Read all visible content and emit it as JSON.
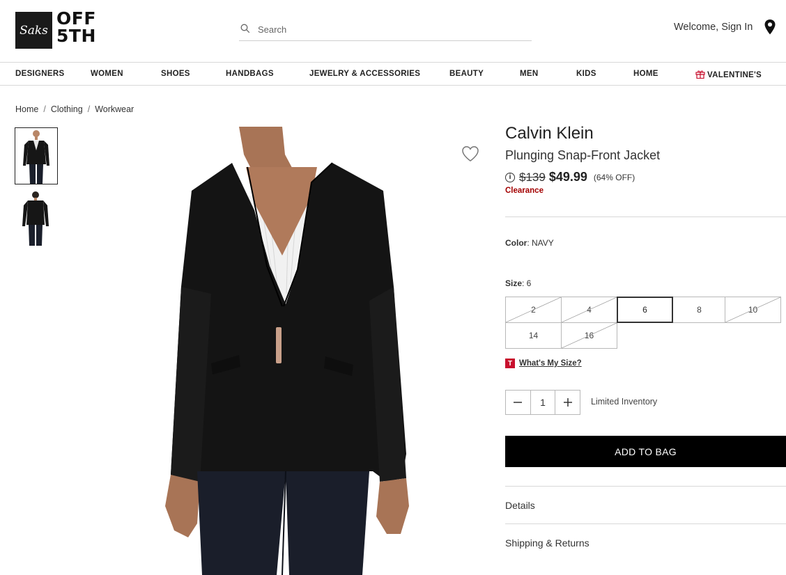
{
  "header": {
    "logo_script": "Saks",
    "logo_line1": "OFF",
    "logo_line2": "5TH",
    "search_placeholder": "Search",
    "welcome": "Welcome, Sign In"
  },
  "nav": [
    "DESIGNERS",
    "WOMEN",
    "SHOES",
    "HANDBAGS",
    "JEWELRY & ACCESSORIES",
    "BEAUTY",
    "MEN",
    "KIDS",
    "HOME",
    "VALENTINE'S"
  ],
  "breadcrumb": [
    "Home",
    "Clothing",
    "Workwear"
  ],
  "product": {
    "brand": "Calvin Klein",
    "name": "Plunging Snap-Front Jacket",
    "original_price": "$139",
    "sale_price": "$49.99",
    "discount": "(64% OFF)",
    "badge": "Clearance",
    "color_label": "Color",
    "color_value": ": NAVY",
    "size_label": "Size",
    "size_value": ": 6",
    "sizes": [
      {
        "label": "2",
        "available": false
      },
      {
        "label": "4",
        "available": false
      },
      {
        "label": "6",
        "available": true,
        "selected": true
      },
      {
        "label": "8",
        "available": true
      },
      {
        "label": "10",
        "available": false
      },
      {
        "label": "14",
        "available": true
      },
      {
        "label": "16",
        "available": false
      }
    ],
    "whats_my_size": "What's My Size?",
    "quantity": "1",
    "inventory_note": "Limited Inventory",
    "add_to_bag": "ADD TO BAG",
    "accordions": [
      "Details",
      "Shipping & Returns"
    ]
  },
  "colors": {
    "clearance": "#a30000",
    "button_bg": "#000000",
    "size_brand": "#c8102e"
  },
  "icons": [
    "search-icon",
    "location-pin-icon",
    "gift-icon",
    "heart-icon",
    "info-icon",
    "minus-icon",
    "plus-icon"
  ]
}
